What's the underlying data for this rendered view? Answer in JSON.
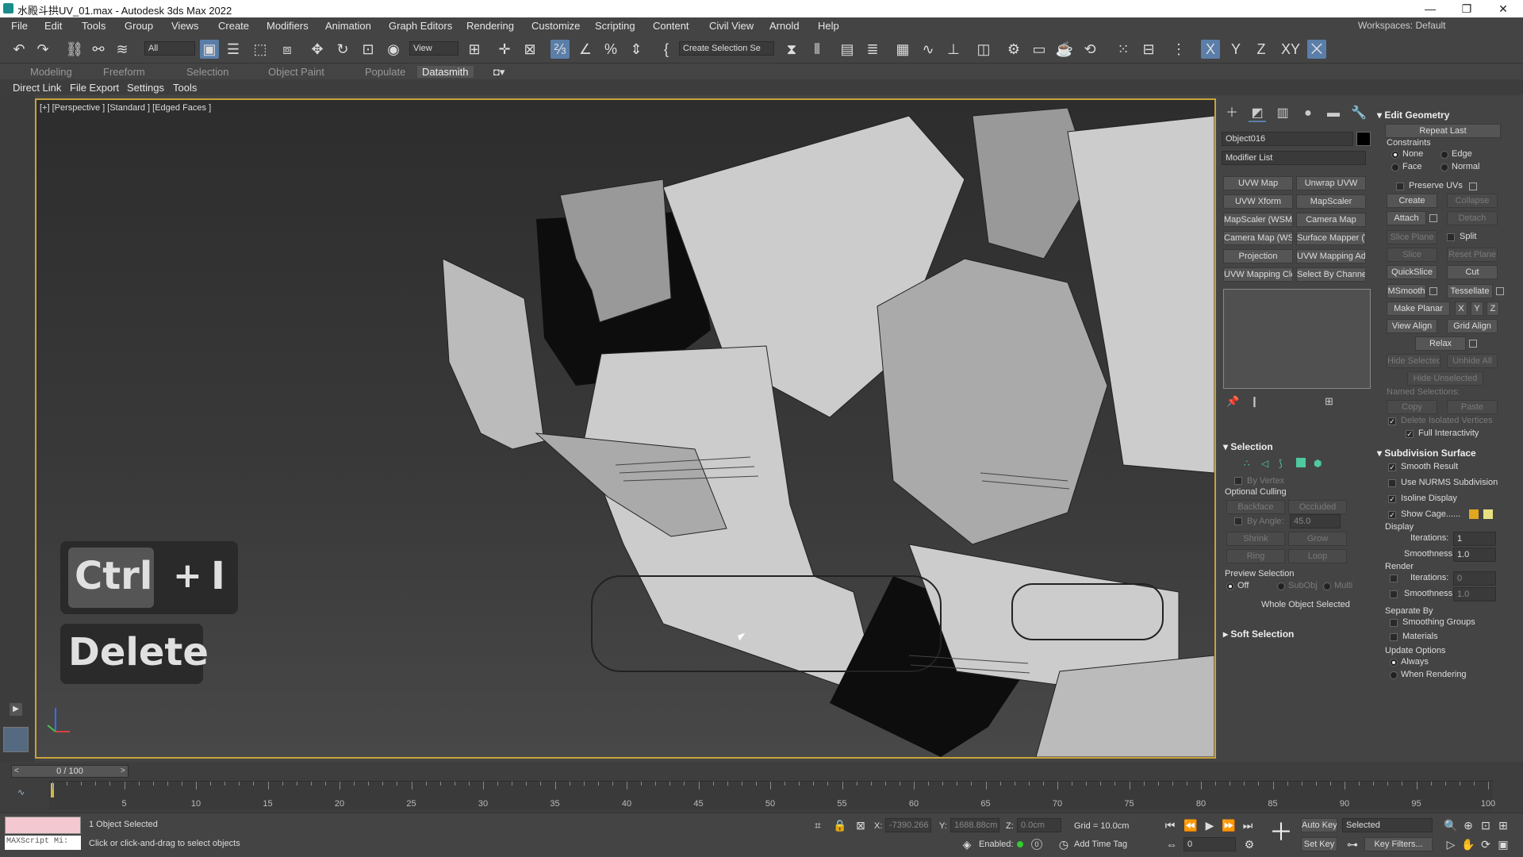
{
  "window": {
    "title": "水殿斗拱UV_01.max - Autodesk 3ds Max 2022",
    "minimize": "—",
    "maximize": "❐",
    "close": "✕"
  },
  "menu": [
    "File",
    "Edit",
    "Tools",
    "Group",
    "Views",
    "Create",
    "Modifiers",
    "Animation",
    "Graph Editors",
    "Rendering",
    "Customize",
    "Scripting",
    "Content",
    "Civil View",
    "Arnold",
    "Help"
  ],
  "workspace": {
    "label": "Workspaces:",
    "value": "Default"
  },
  "toolbar": {
    "filter_value": "All",
    "refcoord_value": "View",
    "selset_placeholder": "Create Selection Se",
    "axes": [
      "X",
      "Y",
      "Z",
      "XY"
    ]
  },
  "ribbon_tabs": [
    "Modeling",
    "Freeform",
    "Selection",
    "Object Paint",
    "Populate",
    "Datasmith"
  ],
  "sub_menu": [
    "Direct Link",
    "File Export",
    "Settings",
    "Tools"
  ],
  "viewport": {
    "label": "[+] [Perspective ] [Standard ] [Edged Faces ]",
    "key_ctrl": "Ctrl",
    "key_plus": "+",
    "key_i": "I",
    "key_delete": "Delete"
  },
  "cmd": {
    "object_name": "Object016",
    "modifier_list": "Modifier List",
    "modifier_buttons": [
      "UVW Map",
      "Unwrap UVW",
      "UVW Xform",
      "MapScaler",
      "MapScaler (WSM)",
      "Camera Map",
      "Camera Map (WSM",
      "Surface Mapper (V",
      "Projection",
      "UVW Mapping Add",
      "UVW Mapping Clea",
      "Select By Channel"
    ],
    "selection": {
      "title": "Selection",
      "by_vertex": "By Vertex",
      "optional_culling": "Optional Culling",
      "backface": "Backface",
      "occluded": "Occluded",
      "by_angle": "By Angle:",
      "angle_value": "45.0",
      "shrink": "Shrink",
      "grow": "Grow",
      "ring": "Ring",
      "loop": "Loop",
      "preview_title": "Preview Selection",
      "off": "Off",
      "subobj": "SubObj",
      "multi": "Multi",
      "status": "Whole Object Selected"
    },
    "soft_selection": "Soft Selection",
    "edit_geometry": {
      "title": "Edit Geometry",
      "repeat_last": "Repeat Last",
      "constraints": "Constraints",
      "none": "None",
      "edge": "Edge",
      "face": "Face",
      "normal": "Normal",
      "preserve_uvs": "Preserve UVs",
      "create": "Create",
      "collapse": "Collapse",
      "attach": "Attach",
      "detach": "Detach",
      "slice_plane": "Slice Plane",
      "split": "Split",
      "slice": "Slice",
      "reset_plane": "Reset Plane",
      "quickslice": "QuickSlice",
      "cut": "Cut",
      "msmooth": "MSmooth",
      "tessellate": "Tessellate",
      "make_planar": "Make Planar",
      "x": "X",
      "y": "Y",
      "z": "Z",
      "view_align": "View Align",
      "grid_align": "Grid Align",
      "relax": "Relax",
      "hide_selected": "Hide Selected",
      "unhide_all": "Unhide All",
      "hide_unselected": "Hide Unselected",
      "named_selections": "Named Selections:",
      "copy": "Copy",
      "paste": "Paste",
      "delete_isolated": "Delete Isolated Vertices",
      "full_interactivity": "Full Interactivity"
    },
    "subdivision": {
      "title": "Subdivision Surface",
      "smooth_result": "Smooth Result",
      "use_nurms": "Use NURMS Subdivision",
      "isoline": "Isoline Display",
      "show_cage": "Show Cage......",
      "display": "Display",
      "iterations": "Iterations:",
      "iter_value": "1",
      "smoothness": "Smoothness:",
      "smooth_value": "1.0",
      "render": "Render",
      "r_iter_value": "0",
      "r_smooth_value": "1.0",
      "separate_by": "Separate By",
      "smoothing_groups": "Smoothing Groups",
      "materials": "Materials",
      "update_options": "Update Options",
      "always": "Always",
      "when_rendering": "When Rendering"
    }
  },
  "timeline": {
    "frame": "0 / 100",
    "ticks": [
      "5",
      "10",
      "15",
      "20",
      "25",
      "30",
      "35",
      "40",
      "45",
      "50",
      "55",
      "60",
      "65",
      "70",
      "75",
      "80",
      "85",
      "90",
      "95",
      "100"
    ]
  },
  "status": {
    "maxscript": "MAXScript Mi:",
    "selected": "1 Object Selected",
    "prompt": "Click or click-and-drag to select objects",
    "x_label": "X:",
    "x_val": "-7390.266",
    "y_label": "Y:",
    "y_val": "1688.88cm",
    "z_label": "Z:",
    "z_val": "0.0cm",
    "grid": "Grid = 10.0cm",
    "enabled": "Enabled:",
    "add_time_tag": "Add Time Tag",
    "auto_key": "Auto Key",
    "set_key": "Set Key",
    "selected_dd": "Selected",
    "frame_val": "0",
    "key_filters": "Key Filters..."
  },
  "colors": {
    "accent": "#5a7ea8",
    "viewport_border": "#c8a23c",
    "cage1": "#e0a820",
    "cage2": "#e8e080"
  }
}
